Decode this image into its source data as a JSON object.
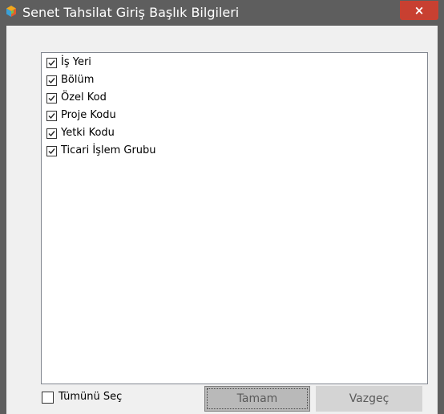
{
  "window": {
    "title": "Senet Tahsilat Giriş Başlık Bilgileri",
    "icon": "app-logo-icon",
    "close_glyph": "×"
  },
  "list": {
    "items": [
      {
        "label": "İş Yeri",
        "checked": true
      },
      {
        "label": "Bölüm",
        "checked": true
      },
      {
        "label": "Özel Kod",
        "checked": true
      },
      {
        "label": "Proje Kodu",
        "checked": true
      },
      {
        "label": "Yetki Kodu",
        "checked": true
      },
      {
        "label": "Ticari İşlem Grubu",
        "checked": true
      }
    ]
  },
  "footer": {
    "select_all_label": "Tümünü Seç",
    "select_all_checked": false,
    "ok_label": "Tamam",
    "cancel_label": "Vazgeç"
  },
  "colors": {
    "titlebar": "#5e5e5e",
    "close_button": "#c84031",
    "ok_button": "#b9b9b9",
    "cancel_button": "#d4d4d4"
  }
}
